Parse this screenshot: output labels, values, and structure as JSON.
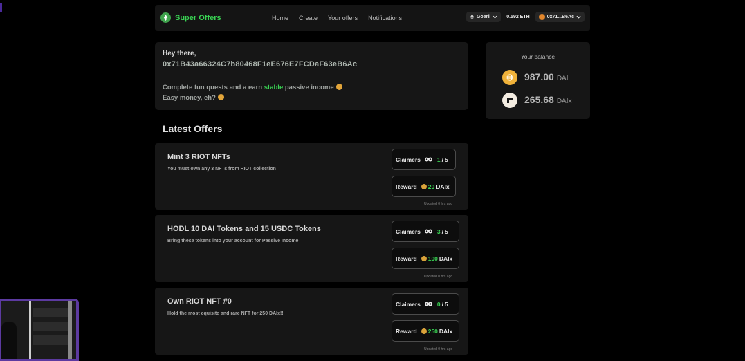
{
  "nav": {
    "brand": "Super Offers",
    "links": [
      "Home",
      "Create",
      "Your offers",
      "Notifications"
    ],
    "network": "Goerli",
    "eth_balance": "0.592 ETH",
    "account": "0x71...B6Ac"
  },
  "greeting": {
    "hello": "Hey there,",
    "address": "0x71B43a66324C7b80468F1eE676E7FCDaF63eB6Ac",
    "line1_prefix": "Complete fun quests and a earn",
    "line1_highlight": "stable",
    "line1_suffix": "passive income",
    "line2": "Easy money, eh?"
  },
  "balance": {
    "title": "Your balance",
    "items": [
      {
        "amount": "987.00",
        "unit": "DAI"
      },
      {
        "amount": "265.68",
        "unit": "DAIx"
      }
    ]
  },
  "section_title": "Latest Offers",
  "offers": [
    {
      "title": "Mint 3 RIOT NFTs",
      "desc": "You must own any 3 NFTs from RIOT collection",
      "claimers_label": "Claimers",
      "claimed": "1",
      "total": "5",
      "reward_label": "Reward",
      "reward_amount": "20",
      "reward_unit": "DAIx",
      "updated": "Updated 0 hrs ago"
    },
    {
      "title": "HODL 10 DAI Tokens and 15 USDC Tokens",
      "desc": "Bring these tokens into your account for Passive Income",
      "claimers_label": "Claimers",
      "claimed": "3",
      "total": "5",
      "reward_label": "Reward",
      "reward_amount": "100",
      "reward_unit": "DAIx",
      "updated": "Updated 0 hrs ago"
    },
    {
      "title": "Own RIOT NFT #0",
      "desc": "Hold the most equisite and rare NFT for 250 DAIx!!",
      "claimers_label": "Claimers",
      "claimed": "0",
      "total": "5",
      "reward_label": "Reward",
      "reward_amount": "250",
      "reward_unit": "DAIx",
      "updated": "Updated 0 hrs ago"
    }
  ],
  "colors": {
    "accent": "#39d353",
    "card": "#161616",
    "background": "#000000"
  },
  "icons": [
    "ethereum-logo-icon",
    "chevron-down-icon",
    "people-icon",
    "coin-icon",
    "dai-icon",
    "daix-icon"
  ]
}
